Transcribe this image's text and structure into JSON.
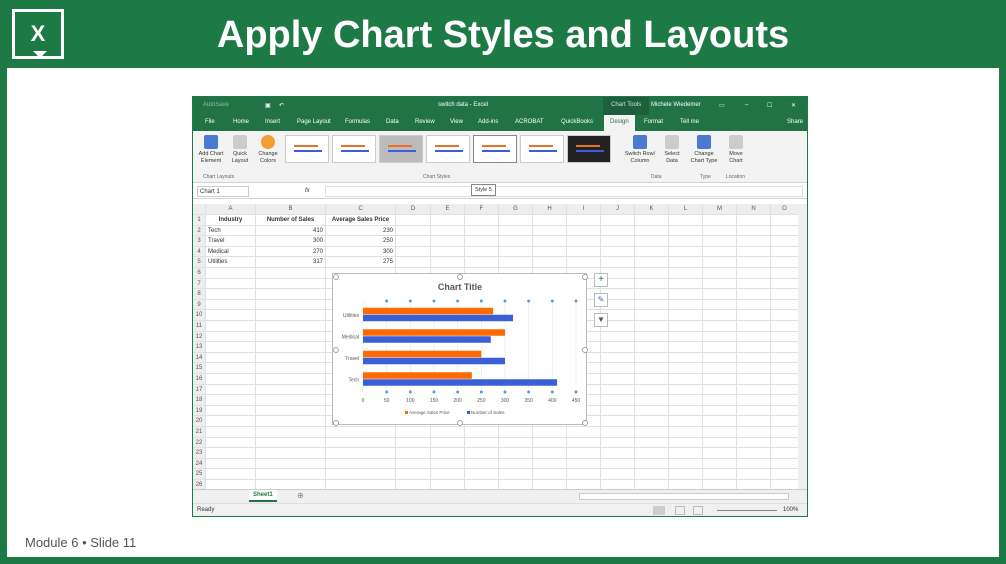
{
  "slide": {
    "title": "Apply Chart Styles and Layouts",
    "footer": "Module 6 • Slide 11",
    "logo": "X"
  },
  "excel": {
    "autosave": "AutoSave",
    "doc_title": "switch data - Excel",
    "context_tab": "Chart Tools",
    "user": "Michele Wiedemer",
    "tabs": [
      "File",
      "Home",
      "Insert",
      "Page Layout",
      "Formulas",
      "Data",
      "Review",
      "View",
      "Add-ins",
      "ACROBAT",
      "QuickBooks",
      "Design",
      "Format",
      "Tell me",
      "Share"
    ],
    "ribbon": {
      "add_chart": "Add Chart Element",
      "quick_layout": "Quick Layout",
      "change_colors": "Change Colors",
      "switch": "Switch Row/ Column",
      "select_data": "Select Data",
      "change_type": "Change Chart Type",
      "move_chart": "Move Chart",
      "groups": [
        "Chart Layouts",
        "Chart Styles",
        "Data",
        "Type",
        "Location"
      ],
      "tooltip": "Style 5"
    },
    "name_box": "Chart 1",
    "fx": "fx",
    "columns": [
      "A",
      "B",
      "C",
      "D",
      "E",
      "F",
      "G",
      "H",
      "I",
      "J",
      "K",
      "L",
      "M",
      "N",
      "O"
    ],
    "headers": [
      "Industry",
      "Number of Sales",
      "Average Sales Price"
    ],
    "rows": [
      [
        "Tech",
        "410",
        "230"
      ],
      [
        "Travel",
        "300",
        "250"
      ],
      [
        "Medical",
        "270",
        "300"
      ],
      [
        "Utilities",
        "317",
        "275"
      ]
    ],
    "sheet_tab": "Sheet1",
    "status": "Ready",
    "zoom": "100%"
  },
  "chart_data": {
    "type": "bar",
    "title": "Chart Title",
    "categories": [
      "Tech",
      "Travel",
      "Medical",
      "Utilities"
    ],
    "series": [
      {
        "name": "Average Sales Price",
        "color": "#ff6a00",
        "values": [
          230,
          250,
          300,
          275
        ]
      },
      {
        "name": "Number of Sales",
        "color": "#3b5fd6",
        "values": [
          410,
          300,
          270,
          317
        ]
      }
    ],
    "xticks": [
      0,
      50,
      100,
      150,
      200,
      250,
      300,
      350,
      400,
      450
    ],
    "xlim": [
      0,
      450
    ],
    "legend": "bottom"
  }
}
